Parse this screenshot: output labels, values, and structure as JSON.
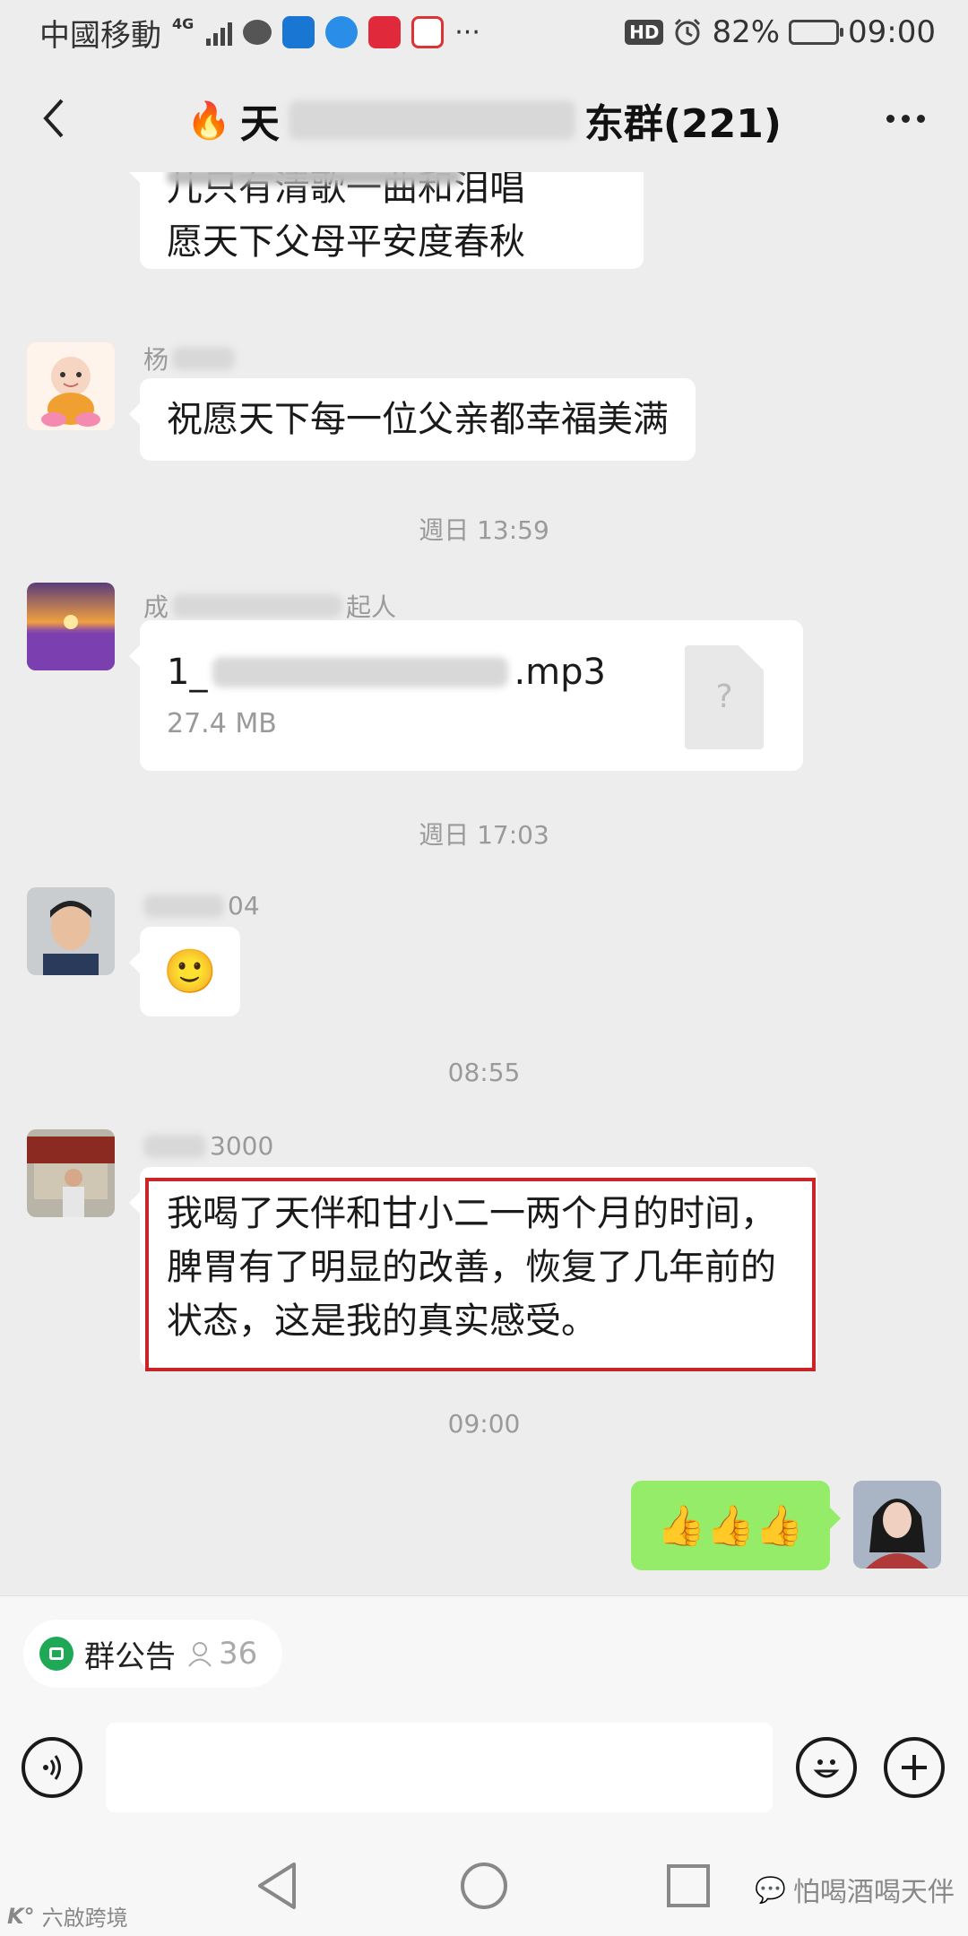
{
  "status_bar": {
    "carrier": "中國移動",
    "network": "4G",
    "battery": "82%",
    "battery_level": 0.82,
    "time": "09:00",
    "hd": "HD"
  },
  "header": {
    "title_start": "天",
    "title_end": "东群(221)",
    "back_label": "back",
    "more_label": "more"
  },
  "messages": {
    "m1_line2": "儿只有清歌一曲和泪唱",
    "m1_line3": "愿天下父母平安度春秋",
    "m2_sender": "杨",
    "m2_text": "祝愿天下每一位父亲都幸福美满",
    "time1": "週日 13:59",
    "m3_sender_start": "成",
    "m3_sender_end": "起人",
    "m3_file_start": "1_",
    "m3_file_end": ".mp3",
    "m3_file_size": "27.4 MB",
    "m3_file_icon": "?",
    "time2": "週日 17:03",
    "m4_sender_end": "04",
    "m4_emoji": "🙂",
    "time3": "08:55",
    "m5_sender_end": "3000",
    "m5_text": "我喝了天伴和甘小二一两个月的时间，脾胃有了明显的改善，恢复了几年前的状态，这是我的真实感受。",
    "time4": "09:00",
    "m6_text": "👍👍👍"
  },
  "announcement": {
    "label": "群公告",
    "count": "36"
  },
  "input": {
    "placeholder": ""
  },
  "watermark": {
    "left": "六啟跨境",
    "right": "怕喝酒喝天伴"
  },
  "colors": {
    "self_bubble": "#95ec69",
    "highlight": "#c8242a",
    "announce_icon": "#1fa855"
  }
}
